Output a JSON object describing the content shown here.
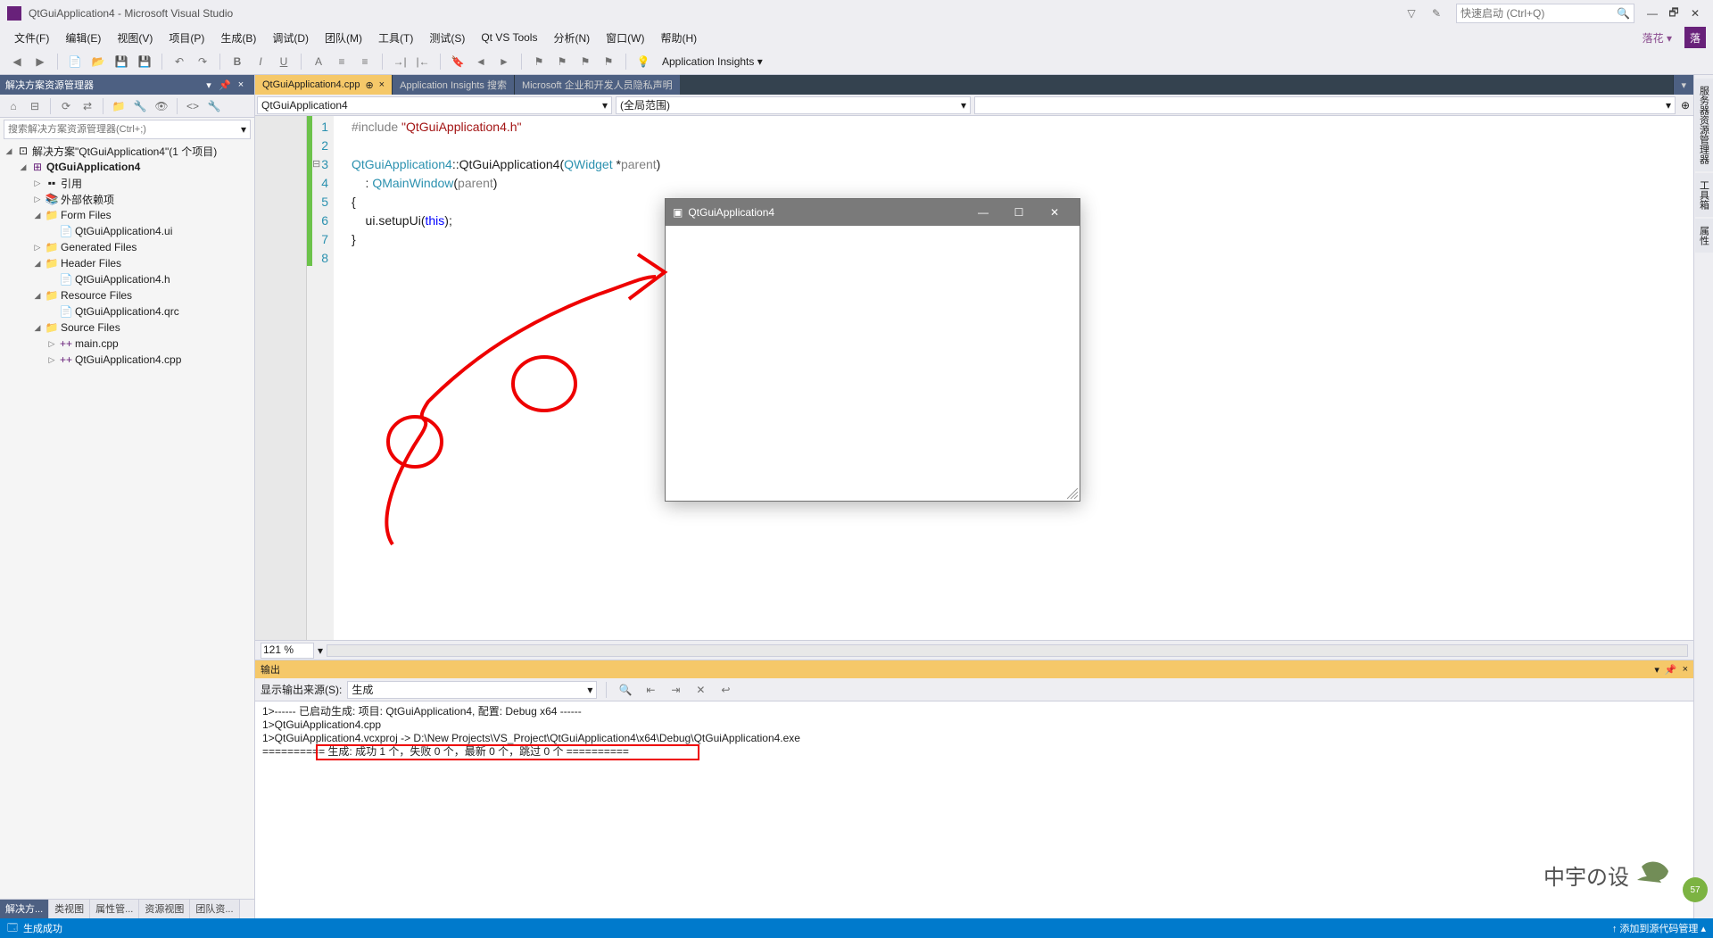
{
  "title": "QtGuiApplication4 - Microsoft Visual Studio",
  "quick_launch_placeholder": "快速启动 (Ctrl+Q)",
  "user_initial": "落",
  "notify_label": "落花 ▾",
  "menu": [
    "文件(F)",
    "编辑(E)",
    "视图(V)",
    "项目(P)",
    "生成(B)",
    "调试(D)",
    "团队(M)",
    "工具(T)",
    "测试(S)",
    "Qt VS Tools",
    "分析(N)",
    "窗口(W)",
    "帮助(H)"
  ],
  "toolbar_insights": "Application Insights ▾",
  "explorer": {
    "title": "解决方案资源管理器",
    "search_placeholder": "搜索解决方案资源管理器(Ctrl+;)",
    "root": "解决方案\"QtGuiApplication4\"(1 个项目)",
    "project": "QtGuiApplication4",
    "nodes": {
      "refs": "引用",
      "ext": "外部依赖项",
      "form": "Form Files",
      "form_ui": "QtGuiApplication4.ui",
      "gen": "Generated Files",
      "hdr": "Header Files",
      "hdr_h": "QtGuiApplication4.h",
      "res": "Resource Files",
      "res_qrc": "QtGuiApplication4.qrc",
      "src": "Source Files",
      "src_main": "main.cpp",
      "src_app": "QtGuiApplication4.cpp"
    },
    "bottom_tabs": [
      "解决方...",
      "类视图",
      "属性管...",
      "资源视图",
      "团队资..."
    ]
  },
  "doc_tabs": {
    "active": "QtGuiApplication4.cpp",
    "pin": "⊕",
    "close": "×",
    "search": "Application Insights 搜索",
    "privacy": "Microsoft 企业和开发人员隐私声明"
  },
  "nav": {
    "left": "QtGuiApplication4",
    "right": "(全局范围)"
  },
  "code": {
    "lines": [
      "1",
      "2",
      "3",
      "4",
      "5",
      "6",
      "7",
      "8"
    ],
    "l1_a": "#include ",
    "l1_b": "\"QtGuiApplication4.h\"",
    "l3_a": "QtGuiApplication4",
    "l3_b": "::QtGuiApplication4(",
    "l3_c": "QWidget",
    "l3_d": " *",
    "l3_e": "parent",
    "l3_f": ")",
    "l4_a": "    : ",
    "l4_b": "QMainWindow",
    "l4_c": "(",
    "l4_d": "parent",
    "l4_e": ")",
    "l5": "{",
    "l6_a": "    ui.setupUi(",
    "l6_b": "this",
    "l6_c": ");",
    "l7": "}"
  },
  "zoom": "121 %",
  "output": {
    "title": "输出",
    "source_label": "显示输出来源(S):",
    "source_value": "生成",
    "lines": [
      "1>------ 已启动生成: 项目: QtGuiApplication4, 配置: Debug x64 ------",
      "1>QtGuiApplication4.cpp",
      "1>QtGuiApplication4.vcxproj -> D:\\New Projects\\VS_Project\\QtGuiApplication4\\x64\\Debug\\QtGuiApplication4.exe",
      "========== 生成: 成功 1 个，失败 0 个，最新 0 个，跳过 0 个 =========="
    ]
  },
  "qt_win": {
    "title": "QtGuiApplication4"
  },
  "right_tabs": [
    "服务器资源管理器",
    "工具箱",
    "属性"
  ],
  "status": {
    "left": "生成成功",
    "right": "↑ 添加到源代码管理 ▴"
  },
  "green_badge": "57"
}
